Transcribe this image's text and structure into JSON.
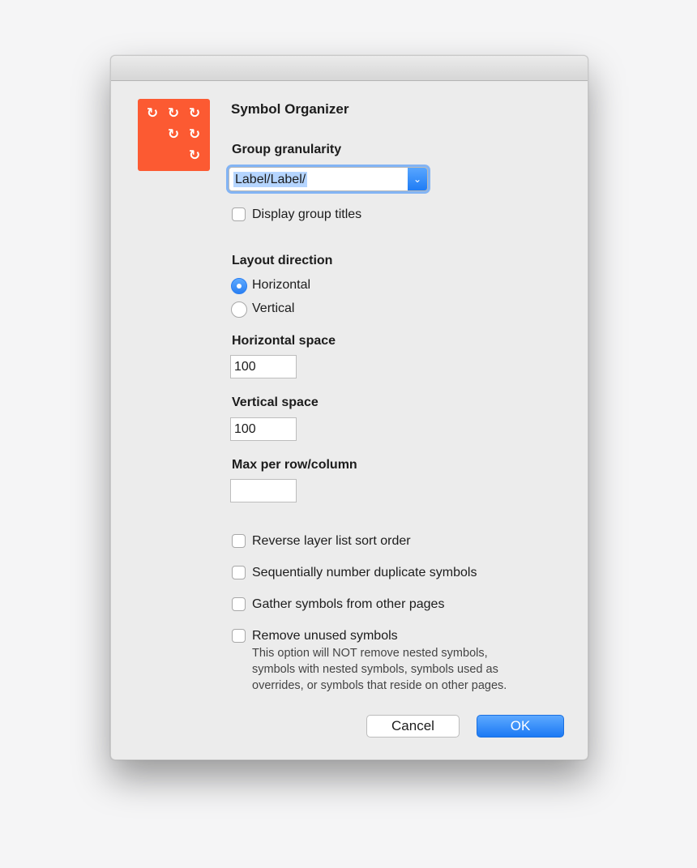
{
  "dialog": {
    "title": "Symbol Organizer"
  },
  "icon": {
    "name": "symbol-organizer-app-icon",
    "color": "#fc5a32",
    "glyph": "↻"
  },
  "group_granularity": {
    "label": "Group granularity",
    "value": "Label/Label/"
  },
  "display_group_titles": {
    "label": "Display group titles",
    "checked": false
  },
  "layout_direction": {
    "label": "Layout direction",
    "options": [
      {
        "label": "Horizontal",
        "selected": true
      },
      {
        "label": "Vertical",
        "selected": false
      }
    ]
  },
  "horizontal_space": {
    "label": "Horizontal space",
    "value": "100"
  },
  "vertical_space": {
    "label": "Vertical space",
    "value": "100"
  },
  "max_per_row_column": {
    "label": "Max per row/column",
    "value": ""
  },
  "options": [
    {
      "label": "Reverse layer list sort order",
      "checked": false
    },
    {
      "label": "Sequentially number duplicate symbols",
      "checked": false
    },
    {
      "label": "Gather symbols from other pages",
      "checked": false
    },
    {
      "label": "Remove unused symbols",
      "checked": false
    }
  ],
  "remove_unused_note": [
    "This option will NOT remove nested symbols,",
    "symbols with nested symbols, symbols used as",
    "overrides, or symbols that reside on other pages."
  ],
  "buttons": {
    "cancel": "Cancel",
    "ok": "OK"
  },
  "colors": {
    "accent": "#2a7ff2",
    "brand": "#fc5a32"
  }
}
